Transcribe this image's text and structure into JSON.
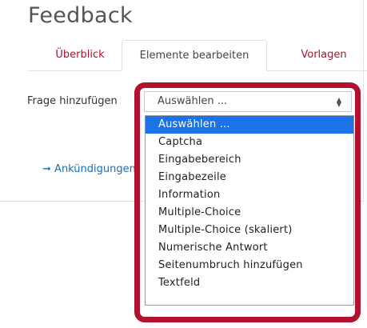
{
  "page": {
    "title": "Feedback"
  },
  "tabs": [
    {
      "label": "Überblick",
      "active": false
    },
    {
      "label": "Elemente bearbeiten",
      "active": true
    },
    {
      "label": "Vorlagen",
      "active": false
    }
  ],
  "form": {
    "add_question_label": "Frage hinzufügen",
    "select_value": "Auswählen ...",
    "options": [
      "Auswählen ...",
      "Captcha",
      "Eingabebereich",
      "Eingabezeile",
      "Information",
      "Multiple-Choice",
      "Multiple-Choice (skaliert)",
      "Numerische Antwort",
      "Seitenumbruch hinzufügen",
      "Textfeld"
    ],
    "selected_index": 0
  },
  "announcement_link": {
    "arrow": "➞",
    "label": "Ankündigungen"
  },
  "colors": {
    "accent": "#b3122f",
    "link": "#b0102e",
    "selected": "#1a73e8"
  }
}
